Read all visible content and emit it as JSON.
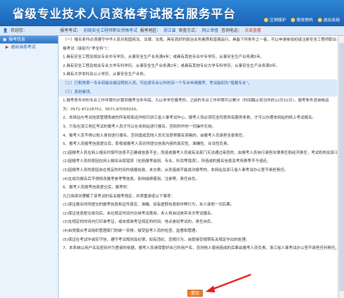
{
  "header": {
    "title": "省级专业技术人员资格考试报名服务平台",
    "links": [
      "注销维护",
      "修改密码",
      "退出系统"
    ]
  },
  "infobar": {
    "welcome_label": "欢迎您：",
    "exam_label": "报考考试：",
    "exam_value": "初级安全工程师职业资格考试",
    "region_label": "报考地区：",
    "region_value": "浙江省",
    "status_label": "审查方式：",
    "status_value": "网上审查",
    "phone_label": "咨询电话：",
    "phone_value": "点击查看"
  },
  "sidebar": {
    "head": "报考信息",
    "items": [
      "退出当前考试"
    ]
  },
  "content": {
    "paragraphs": [
      "（一）报名条件必须遵守中华人民共和国宪法、法律、法规，具有良好的政治业务素质和道德品行，具备下列条件之一者，可以申请参加初级注册安全工程师职业资",
      "格考试（级别为“考全科”）：",
      "1.具有安全工程及相关专业中专学历，从事安全生产业务满4年；或具有其他专业中专学历，从事安全生产业务满5年。",
      "2.具有安全工程及相关专业大学专科学历，从事安全生产业务满2年；或具有其他专业大学专科学历，从事安全生产业务满3年。",
      "3.具有大学本科及以上学历，从事安全生产业务。",
      "（二）已取得某一专业初级合格证明的人员，可在原专业以外的另一个专业申请报考，考试级别为“增报专业”。",
      "（三）其他事项。",
      "1.报考条件中的专业工作年限均计算到报考当年年底。凡以非学历报考的，之前的专业工作年限可以累计（时间截止到当年的12月31日）。报考条件咨询电话",
      "为：0571-87228751、0571-87055020。",
      "2、本网站与考试信息管理系统的所有权和运作权归浙江省人事考试中心，报考人员必须完全同意所有服务条款，才可以办理本网站的网上考试报名。",
      "3、只有在浙江地区考试的报考人员才可以在本网站进行报名，否则所作的一切操作无效。",
      "4、报考人员不得以他人身份进行报名，否则造成其他人员无法获得报名资格的，由报考人员承担全部责任。",
      "5、报考人员报考信息提交后，即视或报考人员对所提交信息内容的真实性、准确性、合法性负责。",
      "(1)因报考人员在网上报名时填写信息不正确或信息不全，而造成报考人员或有关部门无法通过审查的，由报考人员自行承担法律责任和经济责任，考试机构及浙江省人事考试办公室不承担此类责任。",
      "(2)因报考人员的原因在网上报名出现错误（包括报考级别、专业、科目等错误），所造成的报名信息及考务费等不予退还。",
      "(3)因报考人员的原因未在规定的时间内填报信息、未交费，从而造成不能成功报考的，本网站及浙江省人事考试办公室不承担责任。",
      "(4)在成功报名后不得修改报考参考等信息，影响成绩使用、注册等，责任自负。",
      "6、报考人员报考信息提交后，报考时：",
      "  凡已阅读并理解了该考试的有关报考规定，并郑重承诺以下事项：",
      "(1)保证报名时所提交的报考信息和证件真实、准确。如有虚假信息和作弊行为，本人承担一切后果。",
      "(2)保证信息提交成功后，未在规定时间内交纳考试费用，本人将自动放弃本次考试报名。",
      "(3)在规定的时间内打印准考证，或未按准考证规定的时间、地点参加考试的，责任自负。",
      "(4)自觉服从考试组织管理部门的统一安排，接受监考人员的检查、监督和管理。",
      "(5)保证在考试中诚实守信，遵守考试规则及纪律，如有违纪、违规行为，自愿接受按照有关规定作出的处理。",
      "7、本系统以用户名及密码作为登录的依据，报考人员请保管好自己的用户名，否则他人使用造成的后果由报考人员负责，浙江省人事考试办公室不承担任何责任。"
    ],
    "highlighted": [
      5,
      6
    ]
  },
  "submit": {
    "label": "提交"
  },
  "colors": {
    "header": "#1a62b4",
    "accent": "#f08030",
    "arrow": "#e02020"
  }
}
